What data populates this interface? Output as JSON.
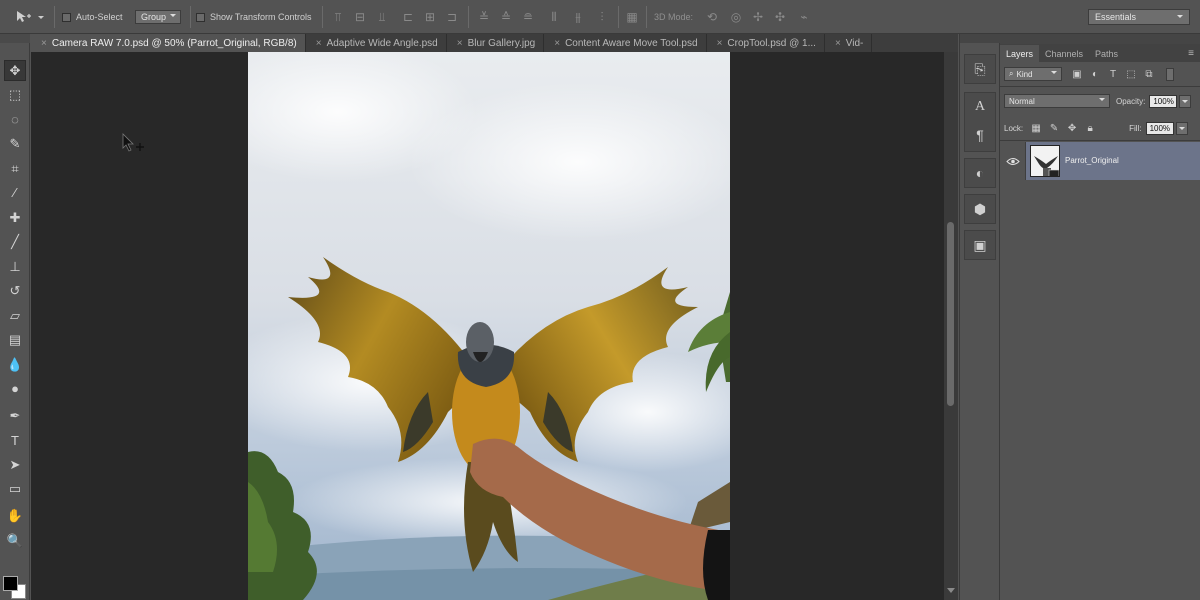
{
  "options_bar": {
    "auto_select_label": "Auto-Select",
    "auto_select_mode": "Group",
    "transform_controls_label": "Show Transform Controls",
    "mode_3d_label": "3D Mode:",
    "workspace": "Essentials"
  },
  "tabs": [
    {
      "label": "Camera RAW 7.0.psd @ 50% (Parrot_Original, RGB/8)",
      "active": true
    },
    {
      "label": "Adaptive Wide Angle.psd",
      "active": false
    },
    {
      "label": "Blur Gallery.jpg",
      "active": false
    },
    {
      "label": "Content Aware Move Tool.psd",
      "active": false
    },
    {
      "label": "CropTool.psd @ 1...",
      "active": false
    },
    {
      "label": "Vid-",
      "active": false
    }
  ],
  "tools": [
    {
      "name": "move-tool-icon",
      "glyph": "✥",
      "active": true
    },
    {
      "name": "marquee-tool-icon",
      "glyph": "⬚"
    },
    {
      "name": "lasso-tool-icon",
      "glyph": "◌"
    },
    {
      "name": "quick-selection-tool-icon",
      "glyph": "✎"
    },
    {
      "name": "crop-tool-icon",
      "glyph": "⌗"
    },
    {
      "name": "eyedropper-tool-icon",
      "glyph": "⁄"
    },
    {
      "name": "healing-brush-tool-icon",
      "glyph": "✚"
    },
    {
      "name": "brush-tool-icon",
      "glyph": "╱"
    },
    {
      "name": "clone-stamp-tool-icon",
      "glyph": "⊥"
    },
    {
      "name": "history-brush-tool-icon",
      "glyph": "↺"
    },
    {
      "name": "eraser-tool-icon",
      "glyph": "▱"
    },
    {
      "name": "gradient-tool-icon",
      "glyph": "▤"
    },
    {
      "name": "blur-tool-icon",
      "glyph": "💧"
    },
    {
      "name": "dodge-tool-icon",
      "glyph": "●"
    },
    {
      "name": "pen-tool-icon",
      "glyph": "✒"
    },
    {
      "name": "type-tool-icon",
      "glyph": "T"
    },
    {
      "name": "path-selection-tool-icon",
      "glyph": "➤"
    },
    {
      "name": "rectangle-tool-icon",
      "glyph": "▭"
    },
    {
      "name": "hand-tool-icon",
      "glyph": "✋"
    },
    {
      "name": "zoom-tool-icon",
      "glyph": "🔍"
    }
  ],
  "layers_panel": {
    "tabs": [
      "Layers",
      "Channels",
      "Paths"
    ],
    "filter_kind": "Kind",
    "blend_mode": "Normal",
    "opacity_label": "Opacity:",
    "opacity_value": "100%",
    "lock_label": "Lock:",
    "fill_label": "Fill:",
    "fill_value": "100%",
    "layers": [
      {
        "name": "Parrot_Original",
        "selected": true,
        "visible": true
      }
    ]
  }
}
